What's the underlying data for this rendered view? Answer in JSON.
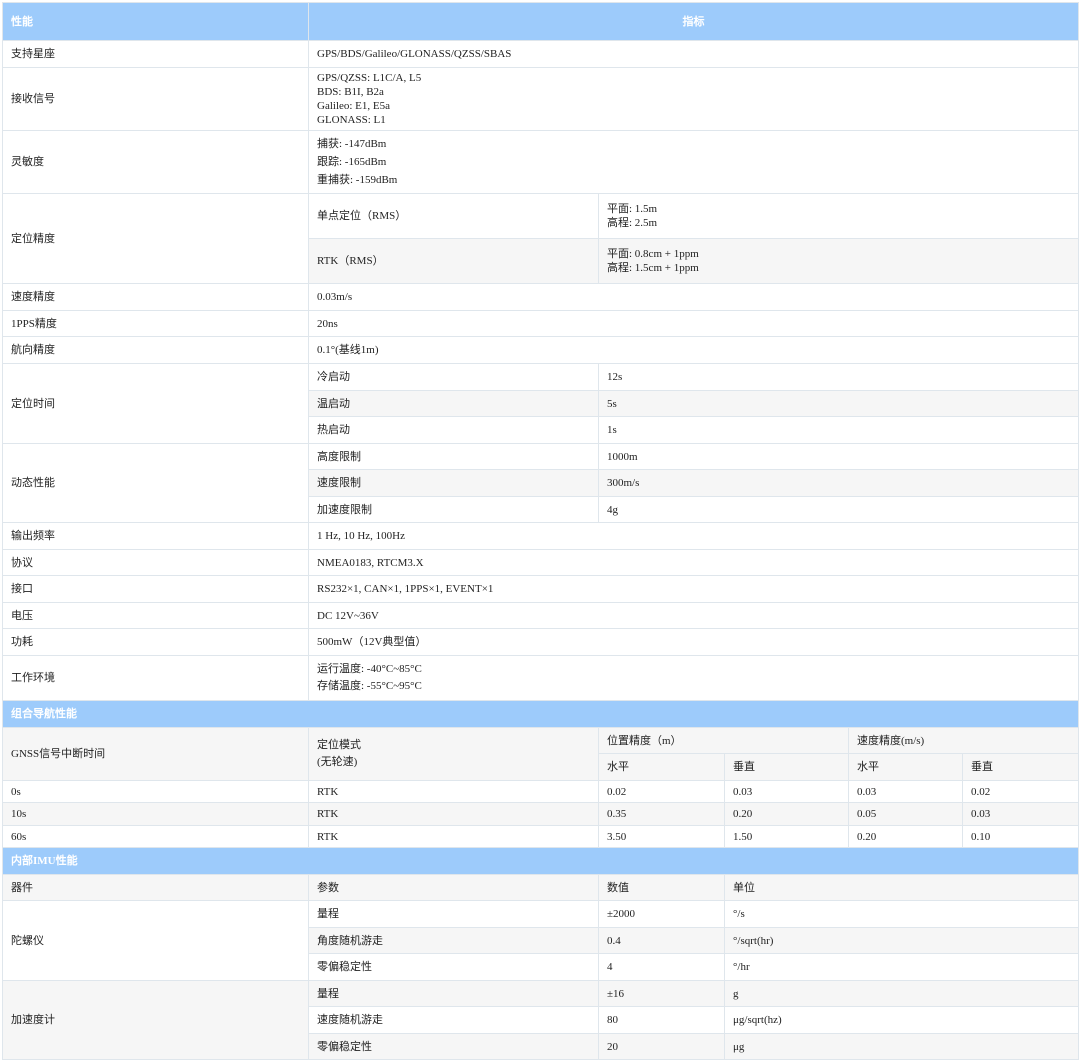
{
  "header": {
    "col1": "性能",
    "col2": "指标"
  },
  "rows": {
    "constellations": {
      "label": "支持星座",
      "value": "GPS/BDS/Galileo/GLONASS/QZSS/SBAS"
    },
    "signals": {
      "label": "接收信号",
      "lines": [
        "GPS/QZSS: L1C/A, L5",
        "BDS: B1I, B2a",
        "Galileo: E1, E5a",
        "GLONASS: L1"
      ]
    },
    "sensitivity": {
      "label": "灵敏度",
      "lines": [
        "捕获: -147dBm",
        "跟踪: -165dBm",
        "重捕获: -159dBm"
      ]
    },
    "accuracy": {
      "label": "定位精度",
      "single": {
        "mode": "单点定位（RMS）",
        "lines": [
          "平面: 1.5m",
          "高程: 2.5m"
        ]
      },
      "rtk": {
        "mode": "RTK（RMS）",
        "lines": [
          "平面: 0.8cm + 1ppm",
          "高程: 1.5cm + 1ppm"
        ]
      }
    },
    "velocity": {
      "label": "速度精度",
      "value": "0.03m/s"
    },
    "pps": {
      "label": "1PPS精度",
      "value": "20ns"
    },
    "heading": {
      "label": "航向精度",
      "value": "0.1°(基线1m)"
    },
    "ttff": {
      "label": "定位时间",
      "items": [
        {
          "k": "冷启动",
          "v": "12s"
        },
        {
          "k": "温启动",
          "v": "5s"
        },
        {
          "k": "热启动",
          "v": "1s"
        }
      ]
    },
    "dynamic": {
      "label": "动态性能",
      "items": [
        {
          "k": "高度限制",
          "v": "1000m"
        },
        {
          "k": "速度限制",
          "v": "300m/s"
        },
        {
          "k": "加速度限制",
          "v": "4g"
        }
      ]
    },
    "rate": {
      "label": "输出频率",
      "value": "1 Hz, 10 Hz, 100Hz"
    },
    "protocol": {
      "label": "协议",
      "value": "NMEA0183, RTCM3.X"
    },
    "interface": {
      "label": "接口",
      "value": "RS232×1, CAN×1, 1PPS×1, EVENT×1"
    },
    "voltage": {
      "label": "电压",
      "value": "DC 12V~36V"
    },
    "power": {
      "label": "功耗",
      "value": "500mW（12V典型值）"
    },
    "environment": {
      "label": "工作环境",
      "lines": [
        "运行温度: -40°C~85°C",
        "存储温度: -55°C~95°C"
      ]
    }
  },
  "ins": {
    "title": "组合导航性能",
    "h_outage": "GNSS信号中断时间",
    "h_mode": [
      "定位模式",
      "(无轮速)"
    ],
    "h_pos": "位置精度（m）",
    "h_vel": "速度精度(m/s)",
    "h_sub": [
      "水平",
      "垂直",
      "水平",
      "垂直"
    ],
    "rows": [
      {
        "t": "0s",
        "mode": "RTK",
        "vals": [
          "0.02",
          "0.03",
          "0.03",
          "0.02"
        ]
      },
      {
        "t": "10s",
        "mode": "RTK",
        "vals": [
          "0.35",
          "0.20",
          "0.05",
          "0.03"
        ]
      },
      {
        "t": "60s",
        "mode": "RTK",
        "vals": [
          "3.50",
          "1.50",
          "0.20",
          "0.10"
        ]
      }
    ]
  },
  "imu": {
    "title": "内部IMU性能",
    "headers": [
      "器件",
      "参数",
      "数值",
      "单位"
    ],
    "gyro": {
      "name": "陀螺仪",
      "rows": [
        {
          "p": "量程",
          "v": "±2000",
          "u": "°/s"
        },
        {
          "p": "角度随机游走",
          "v": "0.4",
          "u": "°/sqrt(hr)"
        },
        {
          "p": "零偏稳定性",
          "v": "4",
          "u": "°/hr"
        }
      ]
    },
    "accel": {
      "name": "加速度计",
      "rows": [
        {
          "p": "量程",
          "v": "±16",
          "u": "g"
        },
        {
          "p": "速度随机游走",
          "v": "80",
          "u": "μg/sqrt(hz)"
        },
        {
          "p": "零偏稳定性",
          "v": "20",
          "u": "μg"
        }
      ]
    }
  }
}
